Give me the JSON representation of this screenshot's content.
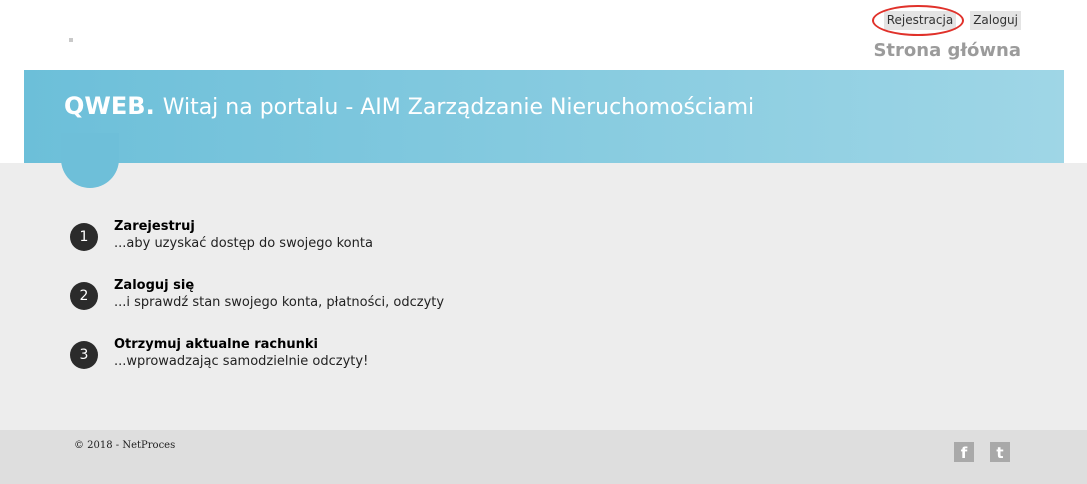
{
  "header": {
    "nav": [
      {
        "label": "Rejestracja"
      },
      {
        "label": "Zaloguj"
      }
    ],
    "page_heading": "Strona główna"
  },
  "hero": {
    "brand": "QWEB.",
    "title": "Witaj na portalu - AIM Zarządzanie Nieruchomościami"
  },
  "steps": [
    {
      "number": "1",
      "title": "Zarejestruj",
      "desc": "...aby uzyskać dostęp do swojego konta"
    },
    {
      "number": "2",
      "title": "Zaloguj się",
      "desc": "...i sprawdź stan swojego konta, płatności, odczyty"
    },
    {
      "number": "3",
      "title": "Otrzymuj aktualne rachunki",
      "desc": "...wprowadzając samodzielnie odczyty!"
    }
  ],
  "footer": {
    "copyright": "© 2018 - NetProces",
    "social": [
      {
        "icon": "facebook-icon",
        "glyph": "f"
      },
      {
        "icon": "twitter-icon",
        "glyph": "t"
      }
    ]
  },
  "colors": {
    "hero_start": "#6cbfd9",
    "hero_end": "#9fd6e6",
    "annotation": "#e0312a"
  }
}
